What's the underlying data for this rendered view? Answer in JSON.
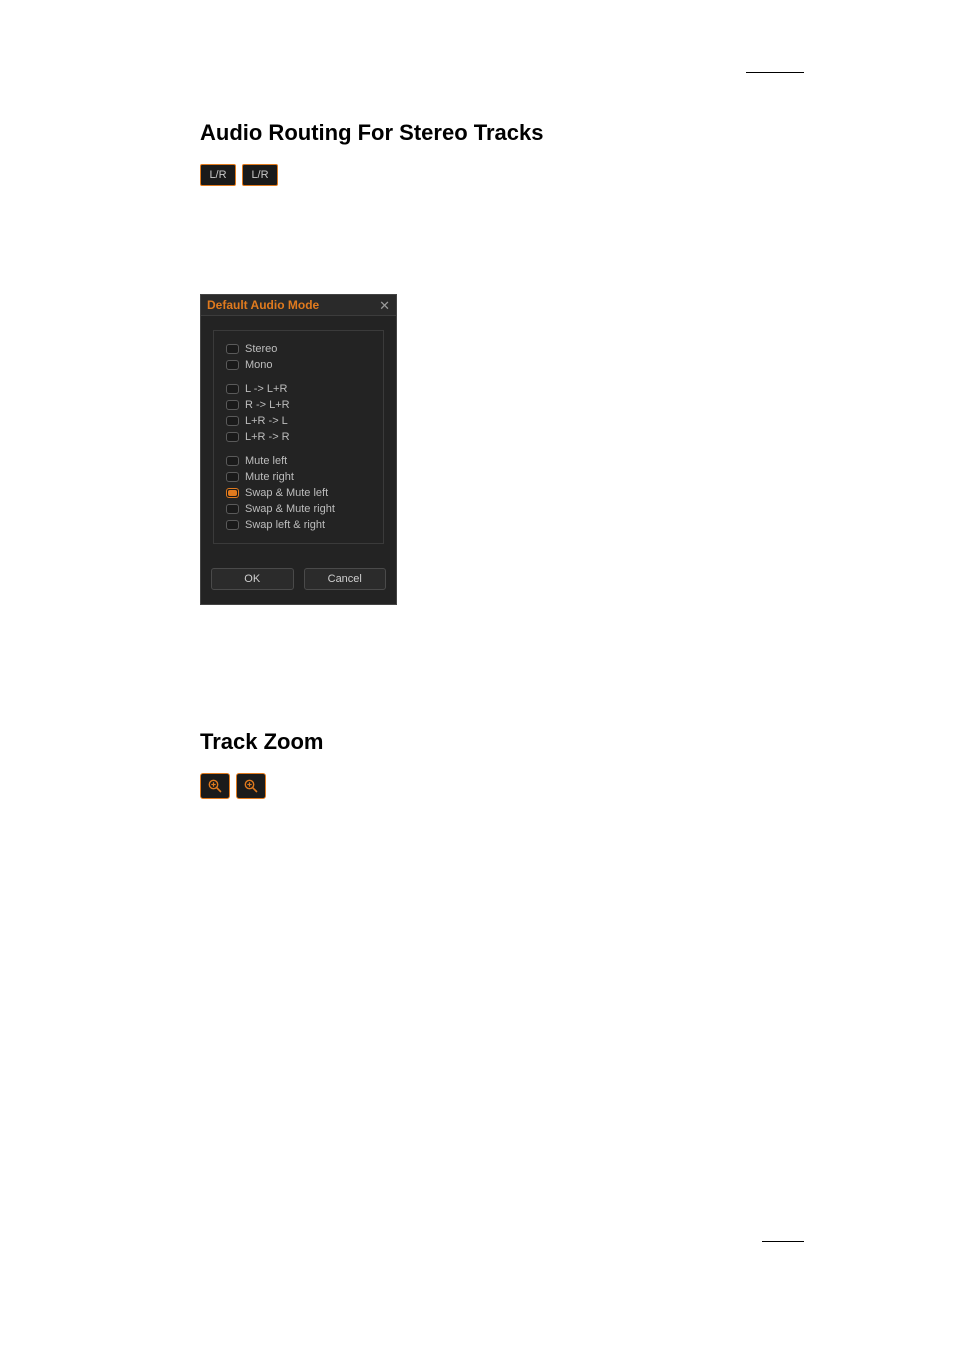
{
  "sections": {
    "audio": {
      "heading": "Audio Routing For Stereo Tracks",
      "lr_badge_text": "L/R"
    },
    "zoom": {
      "heading": "Track Zoom"
    }
  },
  "dialog": {
    "title": "Default Audio Mode",
    "options": [
      {
        "label": "Stereo",
        "selected": false
      },
      {
        "label": "Mono",
        "selected": false
      },
      {
        "label": "L -> L+R",
        "selected": false
      },
      {
        "label": "R -> L+R",
        "selected": false
      },
      {
        "label": "L+R -> L",
        "selected": false
      },
      {
        "label": "L+R -> R",
        "selected": false
      },
      {
        "label": "Mute left",
        "selected": false
      },
      {
        "label": "Mute right",
        "selected": false
      },
      {
        "label": "Swap & Mute left",
        "selected": true
      },
      {
        "label": "Swap & Mute right",
        "selected": false
      },
      {
        "label": "Swap left & right",
        "selected": false
      }
    ],
    "buttons": {
      "ok": "OK",
      "cancel": "Cancel"
    }
  },
  "colors": {
    "accent": "#e07a1e",
    "panel_bg": "#232323",
    "text_muted": "#bdbdbd"
  }
}
